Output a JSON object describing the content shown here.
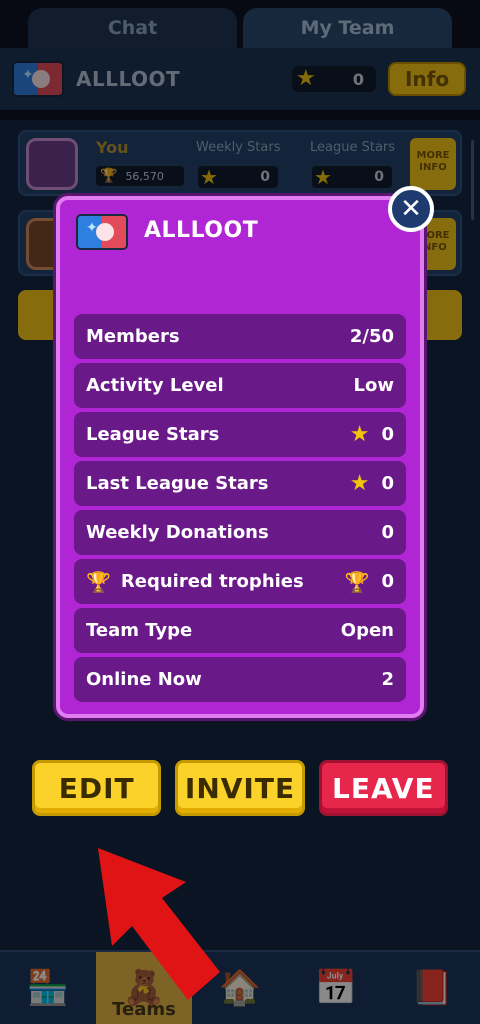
{
  "tabs": [
    {
      "label": "Chat"
    },
    {
      "label": "My Team"
    }
  ],
  "team_header": {
    "name": "ALLLOOT",
    "stars": "0",
    "info_label": "Info"
  },
  "members": [
    {
      "name": "You",
      "trophies": "56,570",
      "weekly_label": "Weekly Stars",
      "weekly": "0",
      "league_label": "League Stars",
      "league": "0",
      "more_label": "MORE INFO"
    },
    {
      "more_label": "MORE INFO"
    }
  ],
  "modal": {
    "title": "ALLLOOT",
    "close_icon": "close-icon",
    "rows": [
      {
        "label": "Members",
        "value": "2/50"
      },
      {
        "label": "Activity Level",
        "value": "Low"
      },
      {
        "label": "League Stars",
        "value": "0",
        "icon": "star"
      },
      {
        "label": "Last League Stars",
        "value": "0",
        "icon": "star"
      },
      {
        "label": "Weekly Donations",
        "value": "0"
      },
      {
        "label": "Required trophies",
        "value": "0",
        "icon": "trophy"
      },
      {
        "label": "Team Type",
        "value": "Open"
      },
      {
        "label": "Online Now",
        "value": "2"
      }
    ]
  },
  "actions": {
    "edit": "EDIT",
    "invite": "INVITE",
    "leave": "LEAVE"
  },
  "bottom_nav": {
    "items": [
      "shop",
      "teams",
      "home",
      "events",
      "collection"
    ],
    "active_label": "Teams"
  },
  "colors": {
    "modal_bg": "#b126d4",
    "row_bg": "#6a1a88",
    "yellow": "#fbd22a",
    "red": "#e6264a",
    "accent_star": "#f1c40f"
  }
}
